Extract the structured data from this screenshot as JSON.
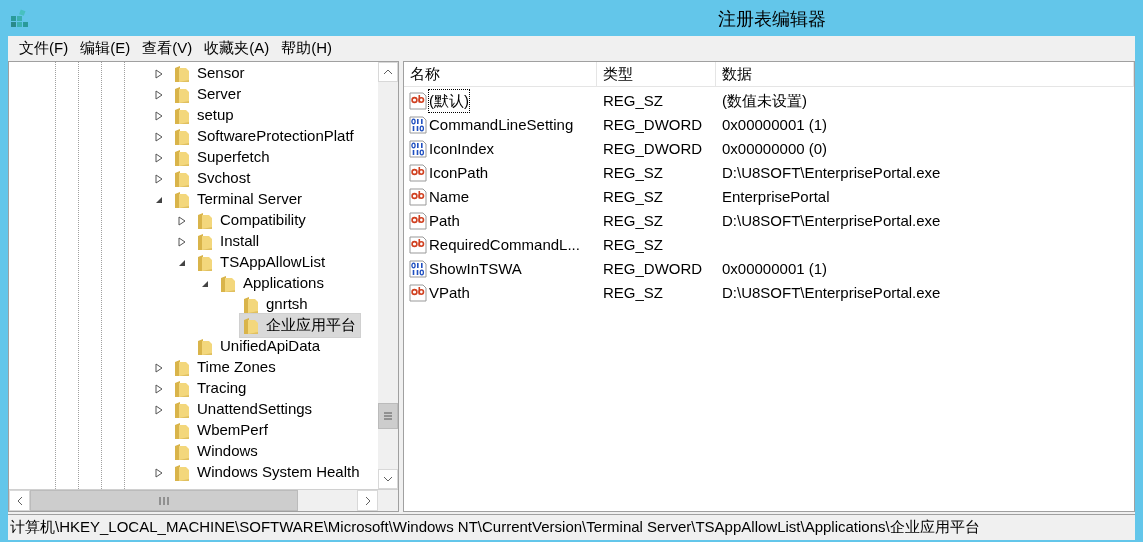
{
  "window": {
    "title": "注册表编辑器"
  },
  "menu": [
    "文件(F)",
    "编辑(E)",
    "查看(V)",
    "收藏夹(A)",
    "帮助(H)"
  ],
  "tree": [
    {
      "label": "Sensor",
      "expanded": false
    },
    {
      "label": "Server",
      "expanded": false
    },
    {
      "label": "setup",
      "expanded": false
    },
    {
      "label": "SoftwareProtectionPlatf",
      "expanded": false
    },
    {
      "label": "Superfetch",
      "expanded": false
    },
    {
      "label": "Svchost",
      "expanded": false
    },
    {
      "label": "Terminal Server",
      "expanded": true,
      "children": [
        {
          "label": "Compatibility",
          "expanded": false
        },
        {
          "label": "Install",
          "expanded": false
        },
        {
          "label": "TSAppAllowList",
          "expanded": true,
          "children": [
            {
              "label": "Applications",
              "expanded": true,
              "children": [
                {
                  "label": "gnrtsh",
                  "selected": false
                },
                {
                  "label": "企业应用平台",
                  "selected": true
                }
              ]
            }
          ]
        },
        {
          "label": "UnifiedApiData"
        }
      ]
    },
    {
      "label": "Time Zones",
      "expanded": false
    },
    {
      "label": "Tracing",
      "expanded": false
    },
    {
      "label": "UnattendSettings",
      "expanded": false
    },
    {
      "label": "WbemPerf"
    },
    {
      "label": "Windows"
    },
    {
      "label": "Windows System Health",
      "expanded": false
    }
  ],
  "table": {
    "columns": [
      "名称",
      "类型",
      "数据"
    ],
    "rows": [
      {
        "kind": "string",
        "name": "(默认)",
        "type": "REG_SZ",
        "data": "(数值未设置)",
        "focused": true
      },
      {
        "kind": "binary",
        "name": "CommandLineSetting",
        "type": "REG_DWORD",
        "data": "0x00000001 (1)",
        "focused": false
      },
      {
        "kind": "binary",
        "name": "IconIndex",
        "type": "REG_DWORD",
        "data": "0x00000000 (0)",
        "focused": false
      },
      {
        "kind": "string",
        "name": "IconPath",
        "type": "REG_SZ",
        "data": "D:\\U8SOFT\\EnterprisePortal.exe",
        "focused": false
      },
      {
        "kind": "string",
        "name": "Name",
        "type": "REG_SZ",
        "data": "EnterprisePortal",
        "focused": false
      },
      {
        "kind": "string",
        "name": "Path",
        "type": "REG_SZ",
        "data": "D:\\U8SOFT\\EnterprisePortal.exe",
        "focused": false
      },
      {
        "kind": "string",
        "name": "RequiredCommandL...",
        "type": "REG_SZ",
        "focused": false
      },
      {
        "kind": "binary",
        "name": "ShowInTSWA",
        "type": "REG_DWORD",
        "data": "0x00000001 (1)",
        "focused": false
      },
      {
        "kind": "string",
        "name": "VPath",
        "type": "REG_SZ",
        "data": "D:\\U8SOFT\\EnterprisePortal.exe",
        "focused": false
      }
    ]
  },
  "status_bar": "计算机\\HKEY_LOCAL_MACHINE\\SOFTWARE\\Microsoft\\Windows NT\\CurrentVersion\\Terminal Server\\TSAppAllowList\\Applications\\企业应用平台"
}
